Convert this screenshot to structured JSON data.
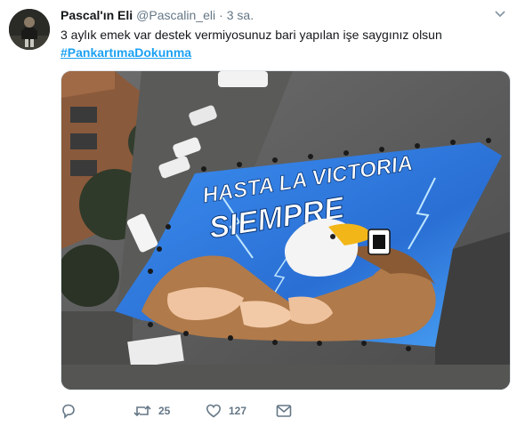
{
  "tweet": {
    "display_name": "Pascal'ın Eli",
    "handle": "@Pascalin_eli",
    "separator": "·",
    "time": "3 sa.",
    "text": "3 aylık emek var destek vermiyosunuz bari yapılan işe saygınız olsun",
    "hashtag": "#PankartımaDokunma",
    "avatar_icon": "avatar-photo",
    "caret_icon": "chevron-down-icon"
  },
  "media": {
    "banner_line1": "HASTA LA VICTORIA",
    "banner_line2": "SIEMPRE",
    "banner_color": "#2f7de0",
    "eagle_colors": {
      "head": "#f4f4f4",
      "beak": "#f2b619",
      "body": "#b07a4a"
    }
  },
  "actions": {
    "reply": {
      "icon": "reply-icon",
      "count": ""
    },
    "retweet": {
      "icon": "retweet-icon",
      "count": "25"
    },
    "like": {
      "icon": "heart-icon",
      "count": "127"
    },
    "message": {
      "icon": "direct-message-icon",
      "count": ""
    }
  },
  "colors": {
    "link": "#1da1f2",
    "secondary_text": "#657786",
    "primary_text": "#14171a"
  }
}
